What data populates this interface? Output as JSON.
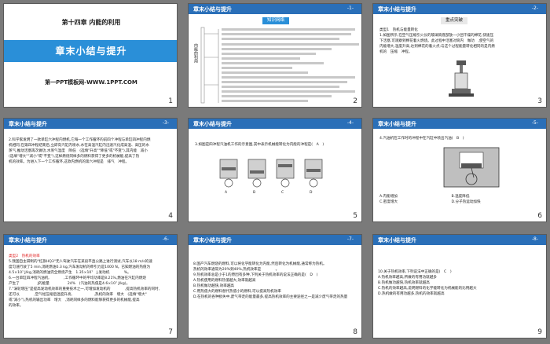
{
  "slides": [
    {
      "number": "1",
      "chapter": "第十四章 内能的利用",
      "title": "章末小结与提升",
      "subtitle": "第一PPT模板网-WWW.1PPT.COM"
    },
    {
      "number": "2",
      "header": "章末小结与提升",
      "page": "-1-",
      "badge": "知识网络",
      "side_label": "内能的利用"
    },
    {
      "number": "3",
      "header": "章末小结与提升",
      "page": "-2-",
      "badge": "重点突破",
      "lines": [
        "类型1　热机与能量转化",
        "1.如图所示,在空气压缩引火仪的玻璃筒底部放一小团干燥的棉花,快速压",
        "下活塞,可观察到棉花着火燃烧。此过程中活塞对筒内　做功　,使空气的",
        "内能增大,温度升高,达到棉花的着火点;与这个过程能量转化相同的是内燃",
        "机的　压缩　冲程。"
      ]
    },
    {
      "number": "4",
      "header": "章末小结与提升",
      "page": "-3-",
      "lines": [
        "2.科学家发明了一款单缸六冲程内燃机,它每一个工作循环的前四个冲程与单缸四冲程内燃",
        "机相同,在第四冲程结束后,立即向汽缸内喷水,水在高温汽缸内迅速汽化成高温、高压的水",
        "蒸气,推动活塞再次做功,水蒸气温度　降低　(选填\"升高\"\"降低\"或\"不变\"),其内能　减小",
        "(选填\"增大\"\"减小\"或\"不变\"),这样燃烧同样多的燃料获得了更多的机械能,提高了热",
        "机的效率。为进入下一个工作循环,这款内燃机的第六冲程是　排气　冲程。"
      ]
    },
    {
      "number": "5",
      "header": "章末小结与提升",
      "page": "-4-",
      "question": "3.如图是四冲程汽油机工作的示意图,其中表示机械能转化为内能的冲程是(　A　)",
      "options": [
        "A",
        "B",
        "C",
        "D"
      ]
    },
    {
      "number": "6",
      "header": "章末小结与提升",
      "page": "-5-",
      "question": "4.汽油机在工作时的冲程中在汽缸中喷出汽油(　B　)",
      "choices": [
        "A.内能增加",
        "B.温度降低",
        "C.密度增大",
        "D.分子热运动加快"
      ]
    },
    {
      "number": "7",
      "header": "章末小结与提升",
      "page": "-6-",
      "lines": [
        "类型2　热机的效率",
        "5.我国自主研制的\"红旗HQ3\"无人驾驶汽车在某段平直公路上进行测试,汽车以18 m/s的速",
        "度匀速行驶了5 min,消耗燃油0.3 kg,汽车发动机的牵引力是1000 N。已知燃油的热值为",
        "4.5×10⁷ J/kg,消耗的燃油完全燃烧产生　1.35×10⁷　J,发动机　　　　%。",
        "6.一台单缸四冲程汽油机,　　　　,工作循环中的平均功率是8.21%,燃油在汽缸内燃烧",
        "产生了　　　　　J的能量　　　　　24%　(汽油的热值是4.6×10⁷ J/kg)。",
        "7.\"涡轮增压\"是提高发动机效率的重要技术之一,可增加发动机的　　　　,提高热机效率的同时,",
        "还可以　　　　,空气经压缩后温度升高,　　　　　　,热机的效率　增大　(选填\"增大\"",
        "或\"减小\"),热机的输出功率　增大　,消耗同样多的燃料能够获得更多的机械能,提高　　　",
        "的效率。"
      ]
    },
    {
      "number": "8",
      "header": "章末小结与提升",
      "page": "-7-",
      "lines": [
        "8.国产汽车燃烧的燃料,可以将化学能转化为内能,然后转化为机械能,通常称为热机。",
        "热机的效率通常为20%到40%,热机效率是　　　　。",
        "9.热机效率总是小于1的原因有多种,下列关于热机效率的说法正确的是(　D　)",
        "A.热机使用的燃料热值越大,效率就越高",
        "B.热机做功越快,效率越高",
        "C.用热值大的燃料替代热值小的燃料,可以提高热机效率",
        "D.在热机的各种损失中,废气带走的能量最多,提高热机效率的主要途径之一是减少废气带走的热量"
      ]
    },
    {
      "number": "9",
      "header": "章末小结与提升",
      "page": "-8-",
      "lines": [
        "10.关于热机效率,下列说法中正确的是(　C　)",
        "A.热机效率越高,所做的有用功就越多",
        "B.热机做功越快,热机效率就越高",
        "C.热机的效率越高,说明燃料的化学能转化为机械能的比例越大",
        "D.热机做的有用功越多,热机的效率就越高"
      ]
    }
  ]
}
